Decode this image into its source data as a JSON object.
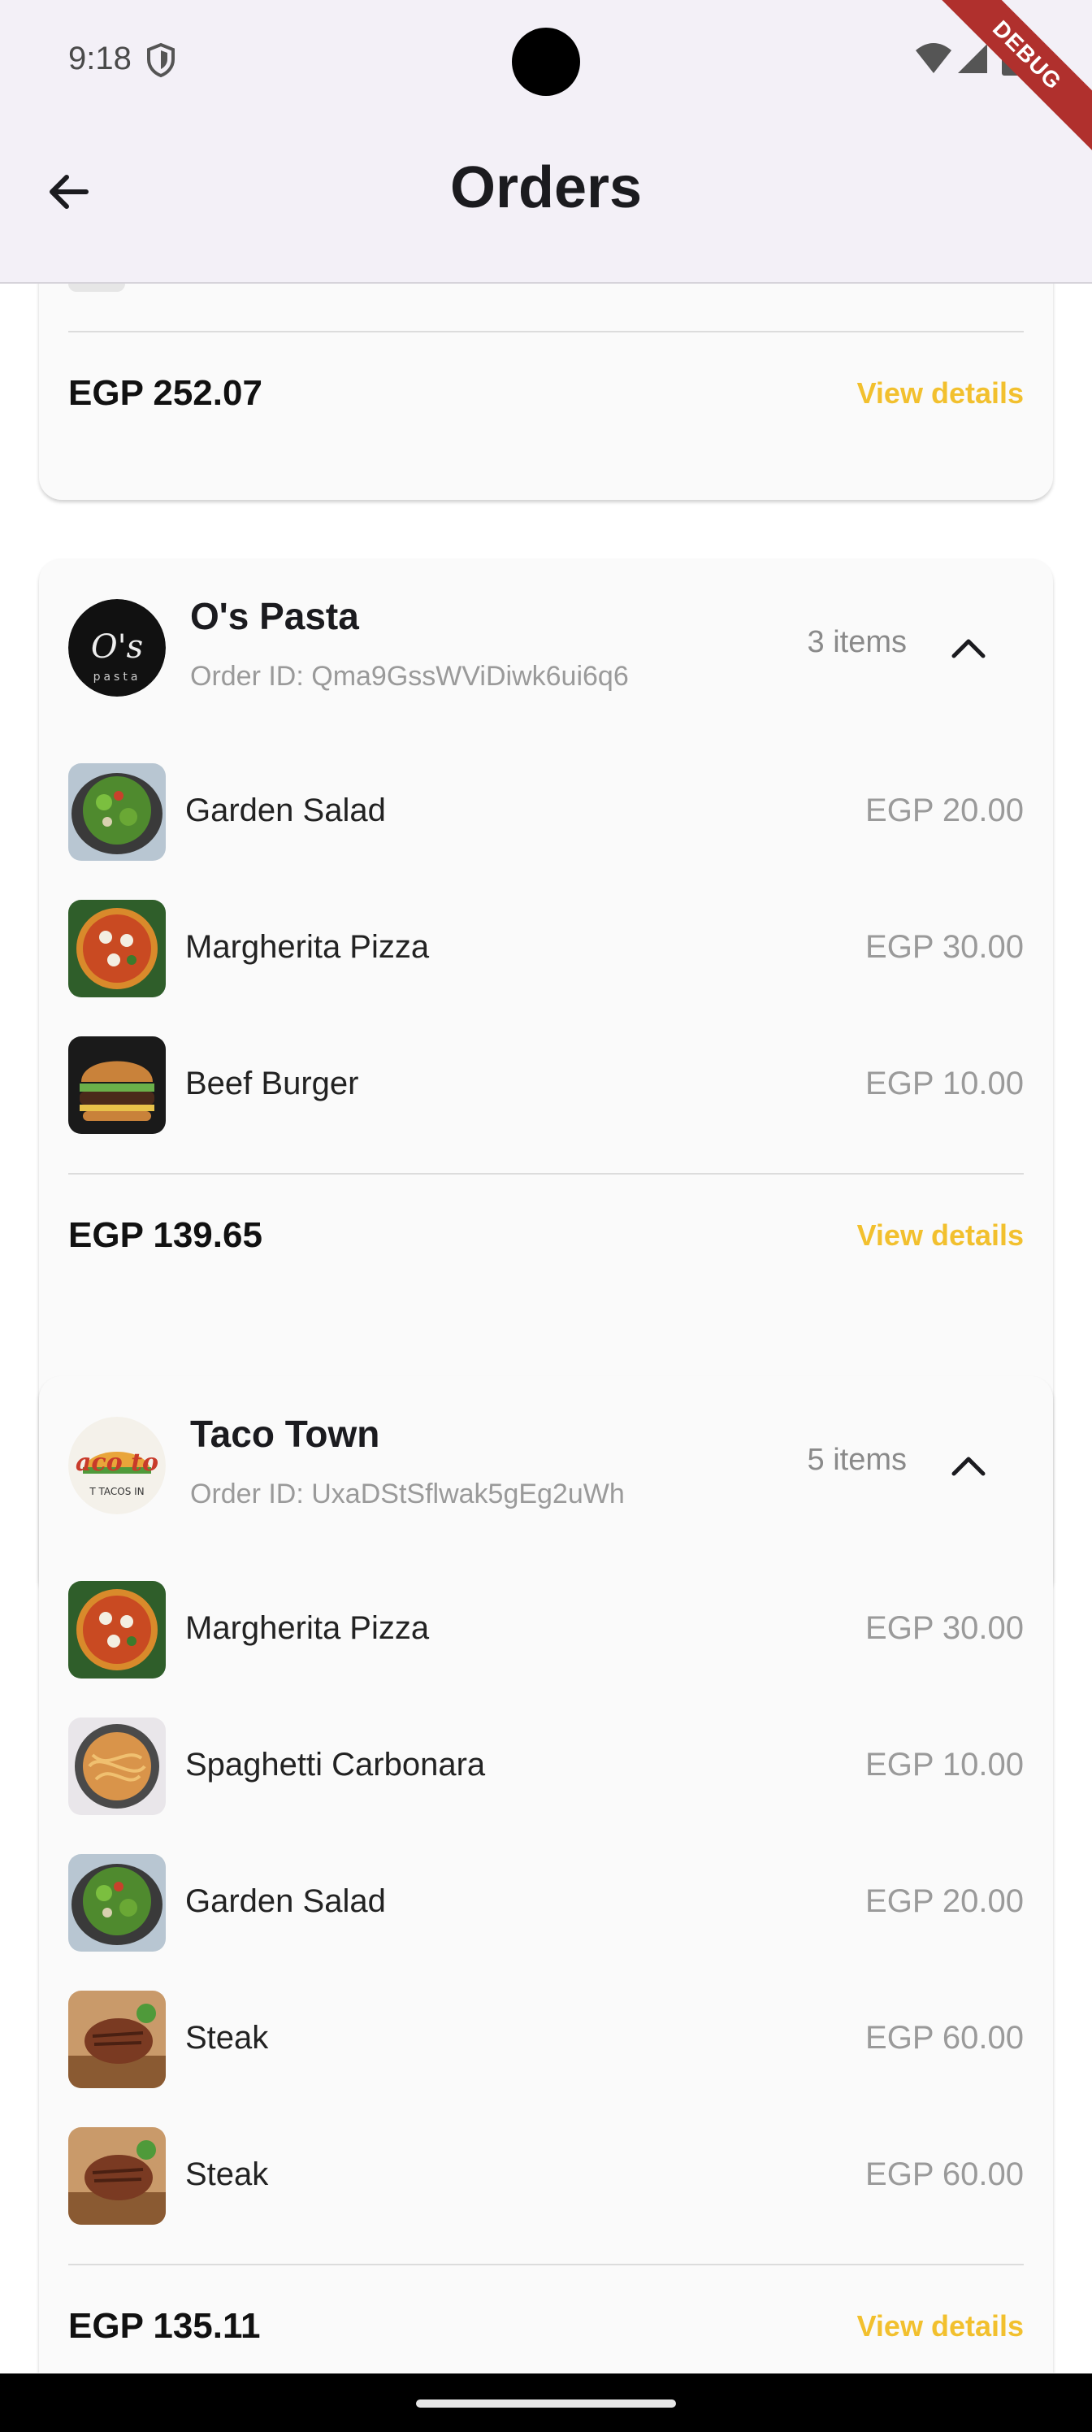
{
  "status_bar": {
    "time": "9:18",
    "debug_label": "DEBUG"
  },
  "header": {
    "title": "Orders"
  },
  "orders": [
    {
      "total": "EGP 252.07",
      "view_details": "View details"
    },
    {
      "restaurant": "O's Pasta",
      "order_id": "Order ID: Qma9GssWViDiwk6ui6q6",
      "items_count": "3 items",
      "items": [
        {
          "name": "Garden Salad",
          "price": "EGP 20.00"
        },
        {
          "name": "Margherita Pizza",
          "price": "EGP 30.00"
        },
        {
          "name": "Beef Burger",
          "price": "EGP 10.00"
        }
      ],
      "total": "EGP 139.65",
      "view_details": "View details"
    },
    {
      "restaurant": "Taco Town",
      "order_id": "Order ID: UxaDStSflwak5gEg2uWh",
      "items_count": "5 items",
      "items": [
        {
          "name": "Margherita Pizza",
          "price": "EGP 30.00"
        },
        {
          "name": "Spaghetti Carbonara",
          "price": "EGP 10.00"
        },
        {
          "name": "Garden Salad",
          "price": "EGP 20.00"
        },
        {
          "name": "Steak",
          "price": "EGP 60.00"
        },
        {
          "name": "Steak",
          "price": "EGP 60.00"
        }
      ],
      "total": "EGP 135.11",
      "view_details": "View details"
    }
  ],
  "colors": {
    "accent": "#f2c02e",
    "appbar": "#f3f0f7"
  }
}
